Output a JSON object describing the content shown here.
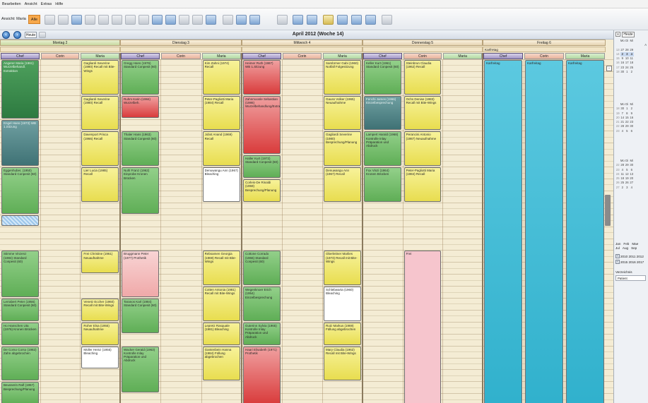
{
  "menu": [
    "Bearbeiten",
    "Ansicht",
    "Extras",
    "Hilfe"
  ],
  "toolbar": {
    "filter_label": "Ansicht: Maria",
    "alle_label": "Alle"
  },
  "nav": {
    "heute_label": "Heute",
    "title": "April 2012 (Woche 14)"
  },
  "days": [
    {
      "label": "Montag 2",
      "selected": true
    },
    {
      "label": "Dienstag 3",
      "selected": false
    },
    {
      "label": "Mittwoch 4",
      "selected": false
    },
    {
      "label": "Donnerstag 5",
      "selected": false
    },
    {
      "label": "Freitag 6",
      "selected": false
    }
  ],
  "friday_note": "Karfretag",
  "persons": [
    "Chef",
    "Corin",
    "Maria"
  ],
  "appointments": [
    {
      "d": 0,
      "c": 0,
      "r": 0,
      "h": 5,
      "cl": "dg",
      "t": "Angerer Maria (1961) Wurzelbehandl. Extraktion"
    },
    {
      "d": 0,
      "c": 0,
      "r": 5,
      "h": 4,
      "cl": "t",
      "t": "Engel Hans (1973) WB 1.Sitzung"
    },
    {
      "d": 0,
      "c": 0,
      "r": 9,
      "h": 4,
      "cl": "g",
      "t": "Eggenhuber, (1950) Standard Conpesit (60)"
    },
    {
      "d": 0,
      "c": 0,
      "r": 13,
      "h": 1,
      "cl": "blk",
      "t": ""
    },
    {
      "d": 0,
      "c": 0,
      "r": 16,
      "h": 4,
      "cl": "g",
      "t": "Stimme Vinzenz (1984) Standard Conpesit (60)"
    },
    {
      "d": 0,
      "c": 0,
      "r": 20,
      "h": 2,
      "cl": "g",
      "t": "Lerrabert Peter (1956) Standard Conpesit (60)"
    },
    {
      "d": 0,
      "c": 0,
      "r": 22,
      "h": 2,
      "cl": "g",
      "t": "Ho Hanschen Uta (1976) Kronen Brücken"
    },
    {
      "d": 0,
      "c": 0,
      "r": 24,
      "h": 3,
      "cl": "g",
      "t": "De Corso Corso (1982) Zahn abgebrochen"
    },
    {
      "d": 0,
      "c": 0,
      "r": 27,
      "h": 2,
      "cl": "g",
      "t": "Beusserin Ralf (1957) Besprechung/Planung"
    },
    {
      "d": 0,
      "c": 2,
      "r": 0,
      "h": 3,
      "cl": "y",
      "t": "Gagliardi Severine (1980) Recall mit Bite-Wings"
    },
    {
      "d": 0,
      "c": 2,
      "r": 3,
      "h": 3,
      "cl": "y",
      "t": "Gagliardi Severine (1980) Recall"
    },
    {
      "d": 0,
      "c": 2,
      "r": 6,
      "h": 3,
      "cl": "y",
      "t": "Davenport Prisca (1966) Recall"
    },
    {
      "d": 0,
      "c": 2,
      "r": 9,
      "h": 3,
      "cl": "y",
      "t": "Lier Lucia (1985) Recall"
    },
    {
      "d": 0,
      "c": 2,
      "r": 16,
      "h": 2,
      "cl": "y",
      "t": "Frei Christine (1961) Neuaufnahme"
    },
    {
      "d": 0,
      "c": 2,
      "r": 20,
      "h": 2,
      "cl": "y",
      "t": "Venetz Eccher (1960) Recall mit Bite-Wings"
    },
    {
      "d": 0,
      "c": 2,
      "r": 22,
      "h": 2,
      "cl": "y",
      "t": "Roher Elsa (1955) Neuaufnahme"
    },
    {
      "d": 0,
      "c": 2,
      "r": 24,
      "h": 2,
      "cl": "w",
      "t": "Müller Heinz (1955) Bleaching"
    },
    {
      "d": 1,
      "c": 0,
      "r": 0,
      "h": 3,
      "cl": "g",
      "t": "Gregg Hans (1976) Standard Conpesit (60)"
    },
    {
      "d": 1,
      "c": 0,
      "r": 3,
      "h": 2,
      "cl": "r",
      "t": "Ruhm Karin (1984) Wurzelbeh."
    },
    {
      "d": 1,
      "c": 0,
      "r": 6,
      "h": 3,
      "cl": "g",
      "t": "Thaler Hans (1963) Standard Conpesit (60)"
    },
    {
      "d": 1,
      "c": 0,
      "r": 9,
      "h": 4,
      "cl": "g",
      "t": "Nuhl Franz (1962) Einprobe Kronen Brücken"
    },
    {
      "d": 1,
      "c": 0,
      "r": 16,
      "h": 4,
      "cl": "rr",
      "t": "Bruggmann Peter (1977) Prothetik"
    },
    {
      "d": 1,
      "c": 0,
      "r": 20,
      "h": 3,
      "cl": "g",
      "t": "Taranos Karl (1984) Standard Conpesit (60)"
    },
    {
      "d": 1,
      "c": 0,
      "r": 24,
      "h": 4,
      "cl": "g",
      "t": "Wacker Gerald (1963) Kontrolle Inlay Präparation und Abdruck"
    },
    {
      "d": 1,
      "c": 2,
      "r": 0,
      "h": 3,
      "cl": "y",
      "t": "Kim Zahni (1974) Recall"
    },
    {
      "d": 1,
      "c": 2,
      "r": 3,
      "h": 3,
      "cl": "y",
      "t": "Peter-Pagliotti Maria (1984) Recall"
    },
    {
      "d": 1,
      "c": 2,
      "r": 6,
      "h": 3,
      "cl": "y",
      "t": "Jobst Anand (1969) Recall"
    },
    {
      "d": 1,
      "c": 2,
      "r": 9,
      "h": 3,
      "cl": "w",
      "t": "Denuwangu Ann (1967) Bleaching"
    },
    {
      "d": 1,
      "c": 2,
      "r": 16,
      "h": 3,
      "cl": "y",
      "t": "Rebsamen Georgia (1969) Recall mit Bite-Wings"
    },
    {
      "d": 1,
      "c": 2,
      "r": 19,
      "h": 3,
      "cl": "y",
      "t": "Cotten Antonia (1981) Recall mit Bite-Wings"
    },
    {
      "d": 1,
      "c": 2,
      "r": 22,
      "h": 2,
      "cl": "y",
      "t": "Lepretz Rasquale (1981) Bleaching"
    },
    {
      "d": 1,
      "c": 2,
      "r": 24,
      "h": 3,
      "cl": "y",
      "t": "Gantenbein Hanna (1984) Füllung abgebrochen"
    },
    {
      "d": 2,
      "c": 0,
      "r": 0,
      "h": 3,
      "cl": "r",
      "t": "Heimer Ruth (1987) WB 1.Sitzung"
    },
    {
      "d": 2,
      "c": 0,
      "r": 3,
      "h": 5,
      "cl": "r",
      "t": "Zahnmoosle Sebastian (1986) Wurzelbehandlung/Extraktion"
    },
    {
      "d": 2,
      "c": 0,
      "r": 8,
      "h": 2,
      "cl": "g",
      "t": "Haller Kurt (1972) Standard Conpesit (60)"
    },
    {
      "d": 2,
      "c": 0,
      "r": 10,
      "h": 2,
      "cl": "y",
      "t": "Corleis-De Rinaldi (1959) Besprechung/Planung"
    },
    {
      "d": 2,
      "c": 0,
      "r": 16,
      "h": 3,
      "cl": "g",
      "t": "Cottone Corrado (1966) Standard Conpesit (60)"
    },
    {
      "d": 2,
      "c": 0,
      "r": 19,
      "h": 3,
      "cl": "g",
      "t": "Wegenknoer Erich (1954) Einzelbesprechung"
    },
    {
      "d": 2,
      "c": 0,
      "r": 22,
      "h": 2,
      "cl": "g",
      "t": "Guterinn Sylvia (1965) Kontrolle Inlay Präparation und Abdruck"
    },
    {
      "d": 2,
      "c": 0,
      "r": 24,
      "h": 5,
      "cl": "r",
      "t": "Haari Elisabeth (1971) Prothetik"
    },
    {
      "d": 2,
      "c": 2,
      "r": 0,
      "h": 3,
      "cl": "y",
      "t": "Sambrmer Gabi (1960) Notfall Folgesitzung"
    },
    {
      "d": 2,
      "c": 2,
      "r": 3,
      "h": 3,
      "cl": "y",
      "t": "Gauss Volker (1965) Neuaufnahme"
    },
    {
      "d": 2,
      "c": 2,
      "r": 6,
      "h": 3,
      "cl": "y",
      "t": "Gagliardi Severine (1980) Besprechung/Planung"
    },
    {
      "d": 2,
      "c": 2,
      "r": 9,
      "h": 3,
      "cl": "y",
      "t": "Denuwangu Ann (1967) Recall"
    },
    {
      "d": 2,
      "c": 2,
      "r": 16,
      "h": 3,
      "cl": "y",
      "t": "Oberleitner Marlies (1973) Recall mit Bite-Wings"
    },
    {
      "d": 2,
      "c": 2,
      "r": 19,
      "h": 3,
      "cl": "w",
      "t": "Schlebwarta (1960) Bleaching"
    },
    {
      "d": 2,
      "c": 2,
      "r": 22,
      "h": 2,
      "cl": "y",
      "t": "Rutz Markus (1969) Füllung abgebrochen"
    },
    {
      "d": 2,
      "c": 2,
      "r": 24,
      "h": 3,
      "cl": "y",
      "t": "Mary Claudia (1962) Recall mit Bite-Wings"
    },
    {
      "d": 3,
      "c": 0,
      "r": 0,
      "h": 3,
      "cl": "g",
      "t": "Keller Kurt (1961) Standard Conpesit (60)"
    },
    {
      "d": 3,
      "c": 0,
      "r": 3,
      "h": 3,
      "cl": "t",
      "t": "Fenchi James (1966) Einzelbesprechung"
    },
    {
      "d": 3,
      "c": 0,
      "r": 6,
      "h": 3,
      "cl": "g",
      "t": "Lampert Harald (1968) Kontrolle Inlay Präparation und Abdruck"
    },
    {
      "d": 3,
      "c": 0,
      "r": 9,
      "h": 3,
      "cl": "g",
      "t": "Fox Vinzi (1964) Kronen Brücken"
    },
    {
      "d": 3,
      "c": 1,
      "r": 16,
      "h": 14,
      "cl": "pk",
      "t": "Frei"
    },
    {
      "d": 3,
      "c": 1,
      "r": 0,
      "h": 3,
      "cl": "y",
      "t": "Steinbrun Claudia (1962) Recall"
    },
    {
      "d": 3,
      "c": 1,
      "r": 3,
      "h": 3,
      "cl": "y",
      "t": "Ochs Denise (1983) Recall mit Bite-Wings"
    },
    {
      "d": 3,
      "c": 1,
      "r": 6,
      "h": 3,
      "cl": "y",
      "t": "Perancini Antonio (1987) Neuaufnahme"
    },
    {
      "d": 3,
      "c": 1,
      "r": 9,
      "h": 3,
      "cl": "y",
      "t": "Peter-Pagliotti Maria (1984) Recall"
    },
    {
      "d": 4,
      "c": 0,
      "r": 0,
      "h": 30,
      "cl": "tl",
      "t": "Karfreitag"
    },
    {
      "d": 4,
      "c": 1,
      "r": 0,
      "h": 30,
      "cl": "tl",
      "t": "Karfreitag"
    },
    {
      "d": 4,
      "c": 2,
      "r": 0,
      "h": 30,
      "cl": "tl",
      "t": "Karfreitag"
    }
  ],
  "right_panel": {
    "close_label": "x",
    "heute_label": "Heute",
    "weekday_header": [
      "Mo",
      "Di",
      "Mi"
    ],
    "month_letter": "A",
    "cal1": [
      [
        "13",
        "27",
        "28",
        "29"
      ],
      [
        "14",
        "2",
        "3",
        "4"
      ],
      [
        "15",
        "9",
        "10",
        "11"
      ],
      [
        "16",
        "16",
        "17",
        "18"
      ],
      [
        "17",
        "23",
        "24",
        "25"
      ],
      [
        "18",
        "30",
        "1",
        "2"
      ]
    ],
    "cal2": [
      [
        "18",
        "30",
        "1",
        "2"
      ],
      [
        "19",
        "7",
        "8",
        "9"
      ],
      [
        "20",
        "14",
        "15",
        "16"
      ],
      [
        "21",
        "21",
        "22",
        "23"
      ],
      [
        "22",
        "28",
        "29",
        "30"
      ],
      [
        "23",
        "4",
        "5",
        "6"
      ]
    ],
    "cal3": [
      [
        "22",
        "28",
        "29",
        "30"
      ],
      [
        "23",
        "4",
        "5",
        "6"
      ],
      [
        "24",
        "11",
        "12",
        "13"
      ],
      [
        "25",
        "18",
        "19",
        "20"
      ],
      [
        "26",
        "25",
        "26",
        "27"
      ],
      [
        "27",
        "2",
        "3",
        "4"
      ]
    ],
    "months_row1": [
      "Jan",
      "Feb",
      "Mae"
    ],
    "months_row2": [
      "Jul",
      "Aug",
      "Sep"
    ],
    "years1": "2010 2011 2012",
    "years2": "2015 2016 2017",
    "filter_label": "Verzeichnis",
    "field_value": "Patient"
  }
}
